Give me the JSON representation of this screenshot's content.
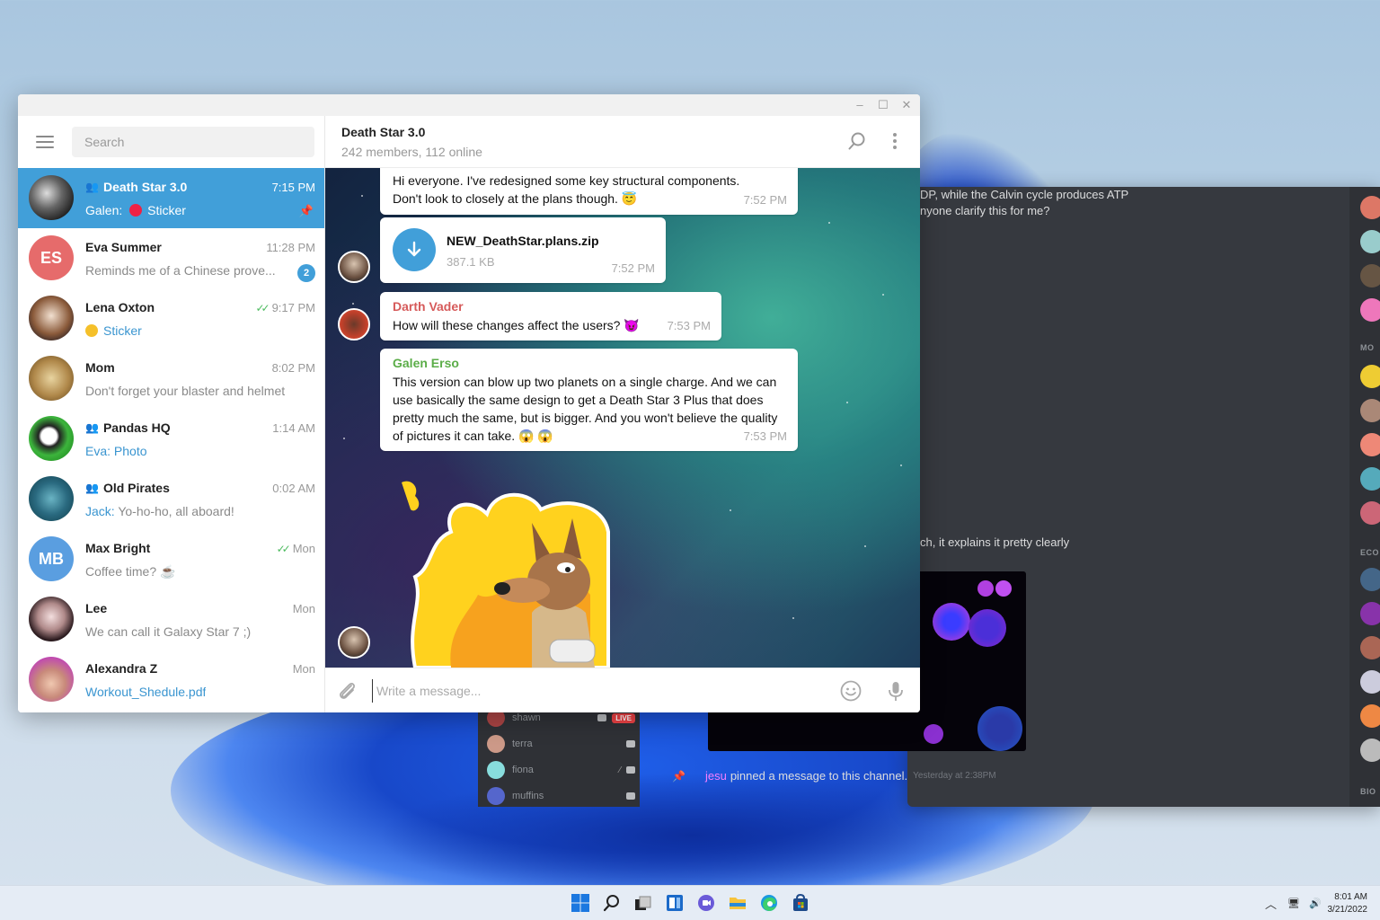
{
  "window": {
    "controls": {
      "minimize": "–",
      "maximize": "☐",
      "close": "✕"
    }
  },
  "sidebar": {
    "search_placeholder": "Search",
    "chats": [
      {
        "name": "Death Star 3.0",
        "group": true,
        "time": "7:15 PM",
        "sender": "Galen:",
        "preview": "Sticker",
        "pinned": true,
        "active": true
      },
      {
        "name": "Eva Summer",
        "initials": "ES",
        "avatar_color": "#e66b6b",
        "time": "11:28 PM",
        "preview": "Reminds me of a Chinese prove...",
        "unread": "2"
      },
      {
        "name": "Lena Oxton",
        "time": "9:17 PM",
        "read": true,
        "preview": "Sticker",
        "preview_is_link": true
      },
      {
        "name": "Mom",
        "time": "8:02 PM",
        "preview": "Don't forget your blaster and helmet"
      },
      {
        "name": "Pandas HQ",
        "group": true,
        "time": "1:14 AM",
        "sender": "Eva:",
        "preview": "Photo",
        "preview_is_link": true
      },
      {
        "name": "Old Pirates",
        "group": true,
        "time": "0:02 AM",
        "sender": "Jack:",
        "preview": "Yo-ho-ho, all aboard!"
      },
      {
        "name": "Max Bright",
        "initials": "MB",
        "avatar_color": "#5a9ee0",
        "time": "Mon",
        "read": true,
        "preview": "Coffee time? ☕"
      },
      {
        "name": "Lee",
        "time": "Mon",
        "preview": "We can call it Galaxy Star 7 ;)"
      },
      {
        "name": "Alexandra Z",
        "time": "Mon",
        "preview": "Workout_Shedule.pdf",
        "preview_is_link": true
      }
    ]
  },
  "chat": {
    "title": "Death Star 3.0",
    "subtitle": "242 members, 112 online",
    "messages": [
      {
        "text": "Hi everyone. I've redesigned some key structural components. Don't look to closely at the plans though. 😇",
        "time": "7:52 PM"
      },
      {
        "file_name": "NEW_DeathStar.plans.zip",
        "file_size": "387.1 KB",
        "time": "7:52 PM"
      },
      {
        "author": "Darth Vader",
        "author_color": "#d65a5a",
        "text": "How will these changes affect the users? 😈",
        "time": "7:53 PM"
      },
      {
        "author": "Galen Erso",
        "author_color": "#5bad48",
        "text": "This version can blow up two planets on a single charge. And we can use basically the same design to get a Death Star 3 Plus that does pretty much the same, but is bigger. And you won't believe the quality of pictures it can take. 😱 😱",
        "time": "7:53 PM"
      }
    ],
    "composer_placeholder": "Write a message..."
  },
  "discord": {
    "msg1_line1": "DP, while the Calvin cycle produces ATP",
    "msg1_line2": "nyone clarify this for me?",
    "msg2": "ch, it explains it pretty clearly",
    "voice_users": [
      {
        "name": "shawn",
        "live": "LIVE"
      },
      {
        "name": "terra"
      },
      {
        "name": "fiona"
      },
      {
        "name": "muffins"
      }
    ],
    "pin_user": "jesu",
    "pin_text": "pinned a message to this channel.",
    "pin_time": "Yesterday at 2:38PM",
    "member_categories": [
      "MO",
      "ECO",
      "BIO"
    ]
  },
  "taskbar": {
    "time": "8:01 AM",
    "date": "3/21/2022",
    "tray_chevron": "^"
  },
  "colors": {
    "accent": "#419fd9",
    "read_check": "#4dbb5f",
    "vader": "#d65a5a",
    "galen": "#5bad48"
  }
}
